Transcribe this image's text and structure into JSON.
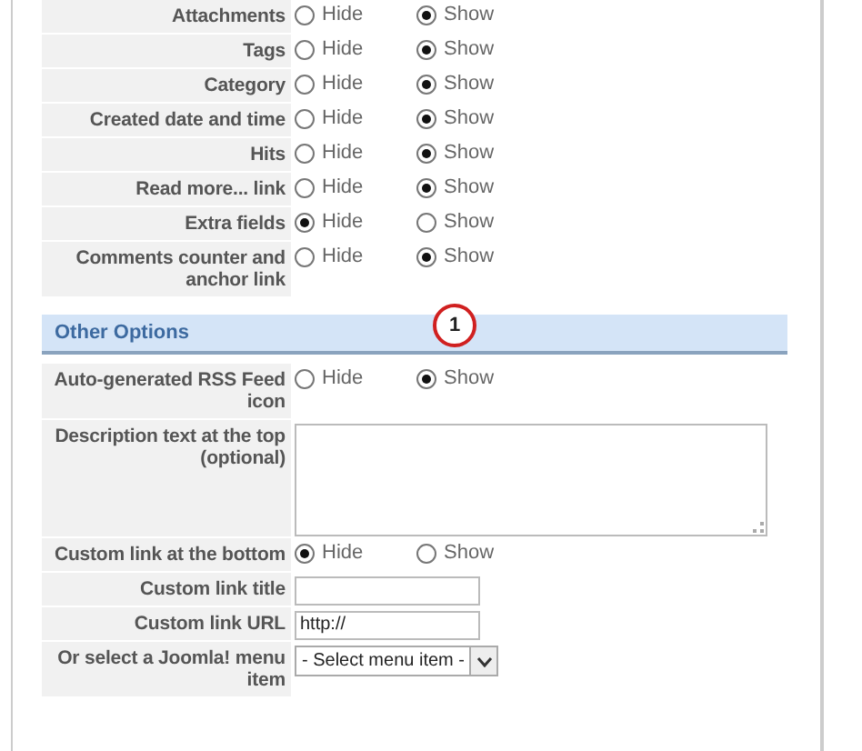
{
  "sections": [
    {
      "rows": [
        {
          "kind": "radio",
          "label": "Attachments",
          "options": [
            {
              "label": "Hide",
              "selected": false
            },
            {
              "label": "Show",
              "selected": true
            }
          ]
        },
        {
          "kind": "radio",
          "label": "Tags",
          "options": [
            {
              "label": "Hide",
              "selected": false
            },
            {
              "label": "Show",
              "selected": true
            }
          ]
        },
        {
          "kind": "radio",
          "label": "Category",
          "options": [
            {
              "label": "Hide",
              "selected": false
            },
            {
              "label": "Show",
              "selected": true
            }
          ]
        },
        {
          "kind": "radio",
          "label": "Created date and time",
          "options": [
            {
              "label": "Hide",
              "selected": false
            },
            {
              "label": "Show",
              "selected": true
            }
          ]
        },
        {
          "kind": "radio",
          "label": "Hits",
          "options": [
            {
              "label": "Hide",
              "selected": false
            },
            {
              "label": "Show",
              "selected": true
            }
          ]
        },
        {
          "kind": "radio",
          "label": "Read more... link",
          "options": [
            {
              "label": "Hide",
              "selected": false
            },
            {
              "label": "Show",
              "selected": true
            }
          ]
        },
        {
          "kind": "radio",
          "label": "Extra fields",
          "options": [
            {
              "label": "Hide",
              "selected": true
            },
            {
              "label": "Show",
              "selected": false
            }
          ]
        },
        {
          "kind": "radio",
          "label": "Comments counter and anchor link",
          "options": [
            {
              "label": "Hide",
              "selected": false
            },
            {
              "label": "Show",
              "selected": true
            }
          ]
        }
      ]
    },
    {
      "title": "Other Options",
      "callout": "1",
      "rows": [
        {
          "kind": "radio",
          "label": "Auto-generated RSS Feed icon",
          "options": [
            {
              "label": "Hide",
              "selected": false
            },
            {
              "label": "Show",
              "selected": true
            }
          ]
        },
        {
          "kind": "textarea",
          "label": "Description text at the top (optional)"
        },
        {
          "kind": "radio",
          "label": "Custom link at the bottom",
          "options": [
            {
              "label": "Hide",
              "selected": true
            },
            {
              "label": "Show",
              "selected": false
            }
          ]
        },
        {
          "kind": "text",
          "label": "Custom link title"
        },
        {
          "kind": "text",
          "label": "Custom link URL",
          "value": "http://"
        },
        {
          "kind": "select",
          "label": "Or select a Joomla! menu item",
          "value": "- Select menu item -"
        }
      ]
    }
  ]
}
